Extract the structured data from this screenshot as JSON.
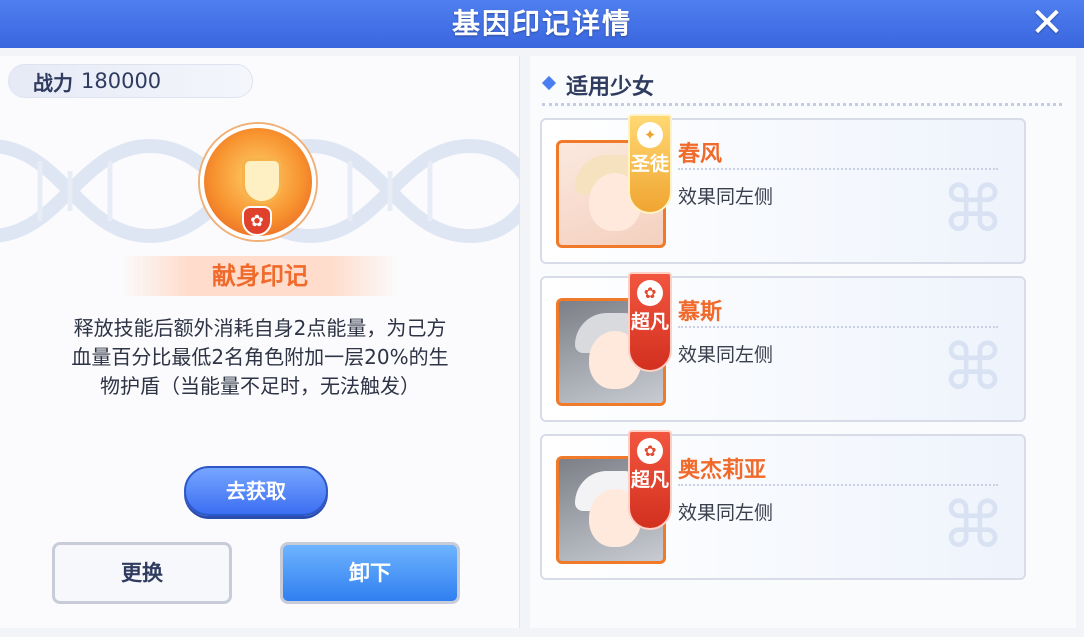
{
  "window": {
    "title": "基因印记详情",
    "close_icon": "close-icon"
  },
  "left": {
    "power_label": "战力",
    "power_value": "180000",
    "mark_icon": "shield-emblem-icon",
    "mark_name": "献身印记",
    "description": "释放技能后额外消耗自身2点能量，为己方血量百分比最低2名角色附加一层20%的生物护盾（当能量不足时，无法触发）",
    "buttons": {
      "obtain": "去获取",
      "replace": "更换",
      "unload": "卸下"
    }
  },
  "right": {
    "section_title": "适用少女",
    "girls": [
      {
        "name": "春风",
        "rank": "圣徒",
        "rank_color": "#f0a531",
        "effect": "效果同左侧"
      },
      {
        "name": "慕斯",
        "rank": "超凡",
        "rank_color": "#d3301f",
        "effect": "效果同左侧"
      },
      {
        "name": "奥杰莉亚",
        "rank": "超凡",
        "rank_color": "#d3301f",
        "effect": "效果同左侧"
      }
    ]
  }
}
